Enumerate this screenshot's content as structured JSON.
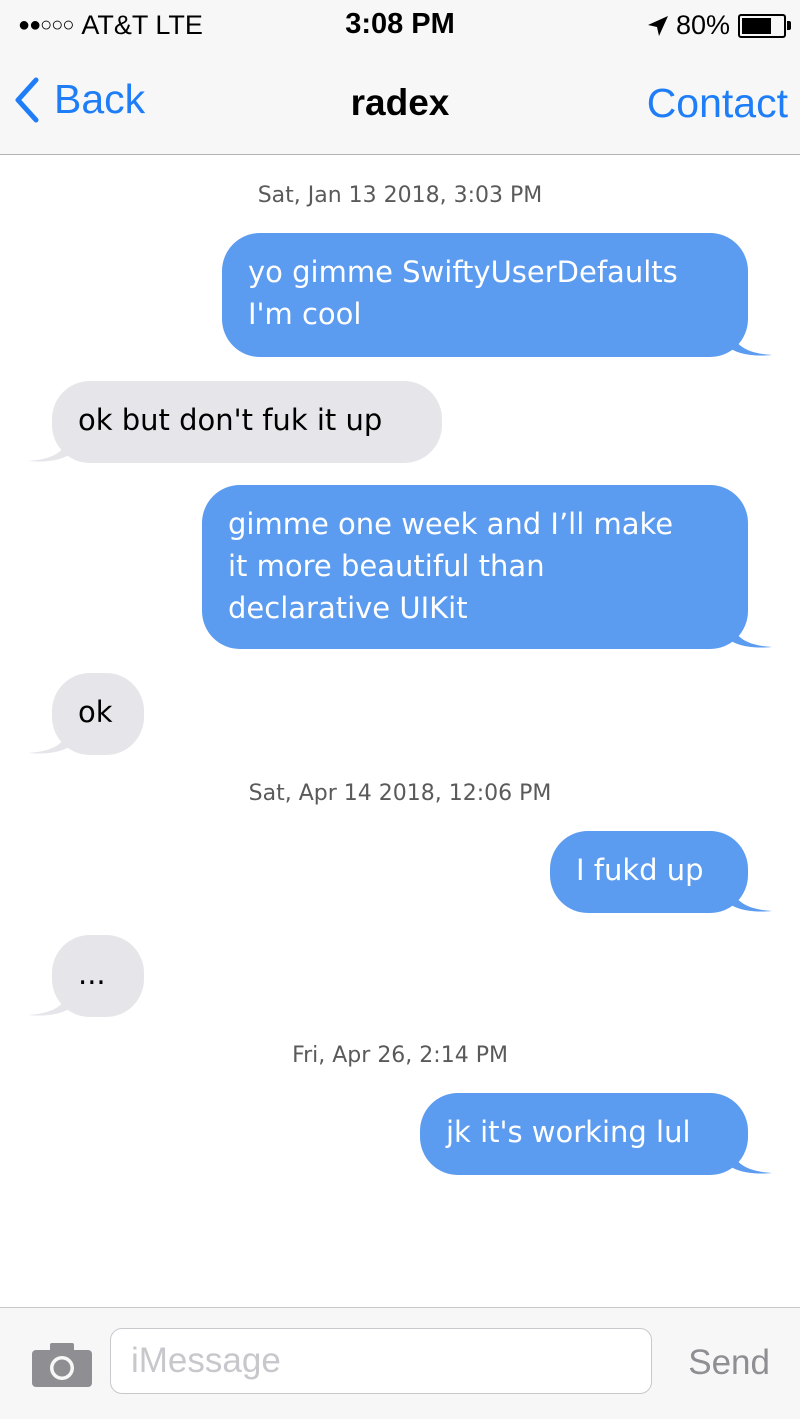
{
  "status_bar": {
    "signal_dots": "●●○○○",
    "carrier": "AT&T LTE",
    "time": "3:08 PM",
    "battery_percent": "80%",
    "battery_level": 0.8,
    "location_icon": "location-arrow-icon"
  },
  "nav": {
    "back_label": "Back",
    "title": "radex",
    "contact_label": "Contact"
  },
  "colors": {
    "accent": "#1f7ef7",
    "outgoing_bubble": "#5b9bf0",
    "incoming_bubble": "#e5e5ea"
  },
  "thread": {
    "timestamps": [
      "Sat, Jan 13 2018, 3:03 PM",
      "Sat, Apr 14 2018, 12:06 PM",
      "Fri, Apr 26, 2:14 PM"
    ],
    "messages": [
      {
        "direction": "outgoing",
        "lines": [
          "yo gimme SwiftyUserDefaults",
          "I'm cool"
        ]
      },
      {
        "direction": "incoming",
        "lines": [
          "ok but don't fuk it up"
        ]
      },
      {
        "direction": "outgoing",
        "lines": [
          "gimme one week and I’ll make",
          "it more beautiful than",
          "declarative UIKit"
        ]
      },
      {
        "direction": "incoming",
        "lines": [
          "ok"
        ]
      },
      {
        "direction": "outgoing",
        "lines": [
          "I fukd up"
        ]
      },
      {
        "direction": "incoming",
        "lines": [
          "..."
        ]
      },
      {
        "direction": "outgoing",
        "lines": [
          "jk it's working lul"
        ]
      }
    ]
  },
  "input_bar": {
    "camera_icon": "camera-icon",
    "placeholder": "iMessage",
    "value": "",
    "send_label": "Send"
  }
}
